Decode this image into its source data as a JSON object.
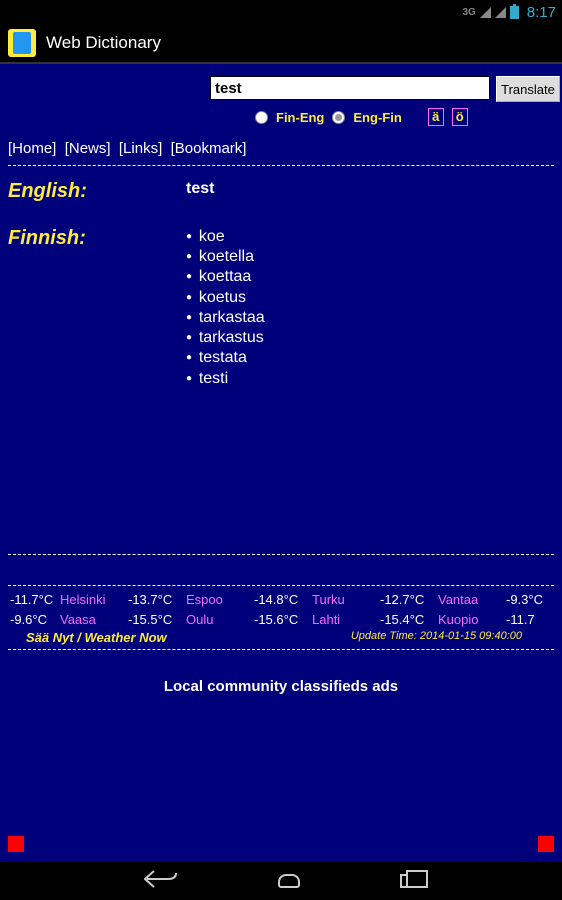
{
  "status": {
    "network": "3G",
    "time": "8:17"
  },
  "app": {
    "title": "Web Dictionary"
  },
  "search": {
    "value": "test",
    "button": "Translate"
  },
  "direction": {
    "opt1": "Fin-Eng",
    "opt2": "Eng-Fin",
    "char1": "ä",
    "char2": "ö"
  },
  "nav": [
    "[Home]",
    "[News]",
    "[Links]",
    "[Bookmark]"
  ],
  "result": {
    "label_english": "English:",
    "english": "test",
    "label_finnish": "Finnish:",
    "finnish": [
      "koe",
      "koetella",
      "koettaa",
      "koetus",
      "tarkastaa",
      "tarkastus",
      "testata",
      "testi"
    ]
  },
  "weather": {
    "rows": [
      {
        "t0": "-11.7°C",
        "c0": "Helsinki",
        "t1": "-13.7°C",
        "c1": "Espoo",
        "t2": "-14.8°C",
        "c2": "Turku",
        "t3": "-12.7°C",
        "c3": "Vantaa",
        "t4": "-9.3°C"
      },
      {
        "t0": "-9.6°C",
        "c0": "Vaasa",
        "t1": "-15.5°C",
        "c1": "Oulu",
        "t2": "-15.6°C",
        "c2": "Lahti",
        "t3": "-15.4°C",
        "c3": "Kuopio",
        "t4": "-11.7"
      }
    ],
    "title": "Sää Nyt / Weather Now",
    "update": "Update Time: 2014-01-15 09:40:00"
  },
  "classifieds": "Local community classifieds ads"
}
